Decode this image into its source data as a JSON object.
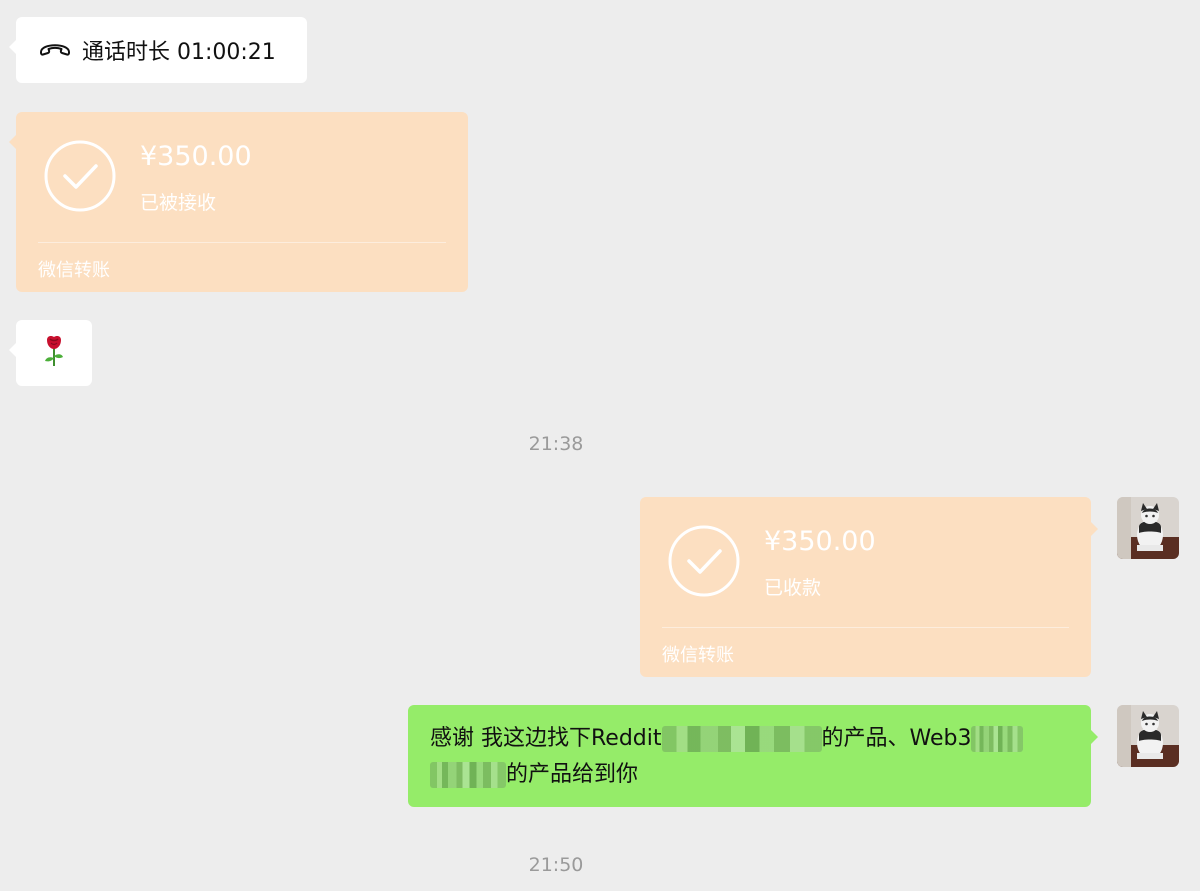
{
  "call": {
    "icon": "phone-hangup-icon",
    "label": "通话时长 01:00:21"
  },
  "transfers": [
    {
      "amount": "¥350.00",
      "status": "已被接收",
      "footer": "微信转账",
      "icon": "check-circle-icon"
    },
    {
      "amount": "¥350.00",
      "status": "已收款",
      "footer": "微信转账",
      "icon": "check-circle-icon"
    }
  ],
  "rose": {
    "icon": "rose-emoji"
  },
  "timestamps": [
    "21:38",
    "21:50"
  ],
  "message": {
    "line1_a": "感谢 我这边找下Reddit",
    "line1_b": "的产品、Web3",
    "line2_b": "的产品给到你"
  },
  "colors": {
    "background": "#ededed",
    "transfer_card": "#fcdfc1",
    "sent_bubble": "#95ec69",
    "received_bubble": "#ffffff",
    "timestamp": "#9a9a9a"
  }
}
